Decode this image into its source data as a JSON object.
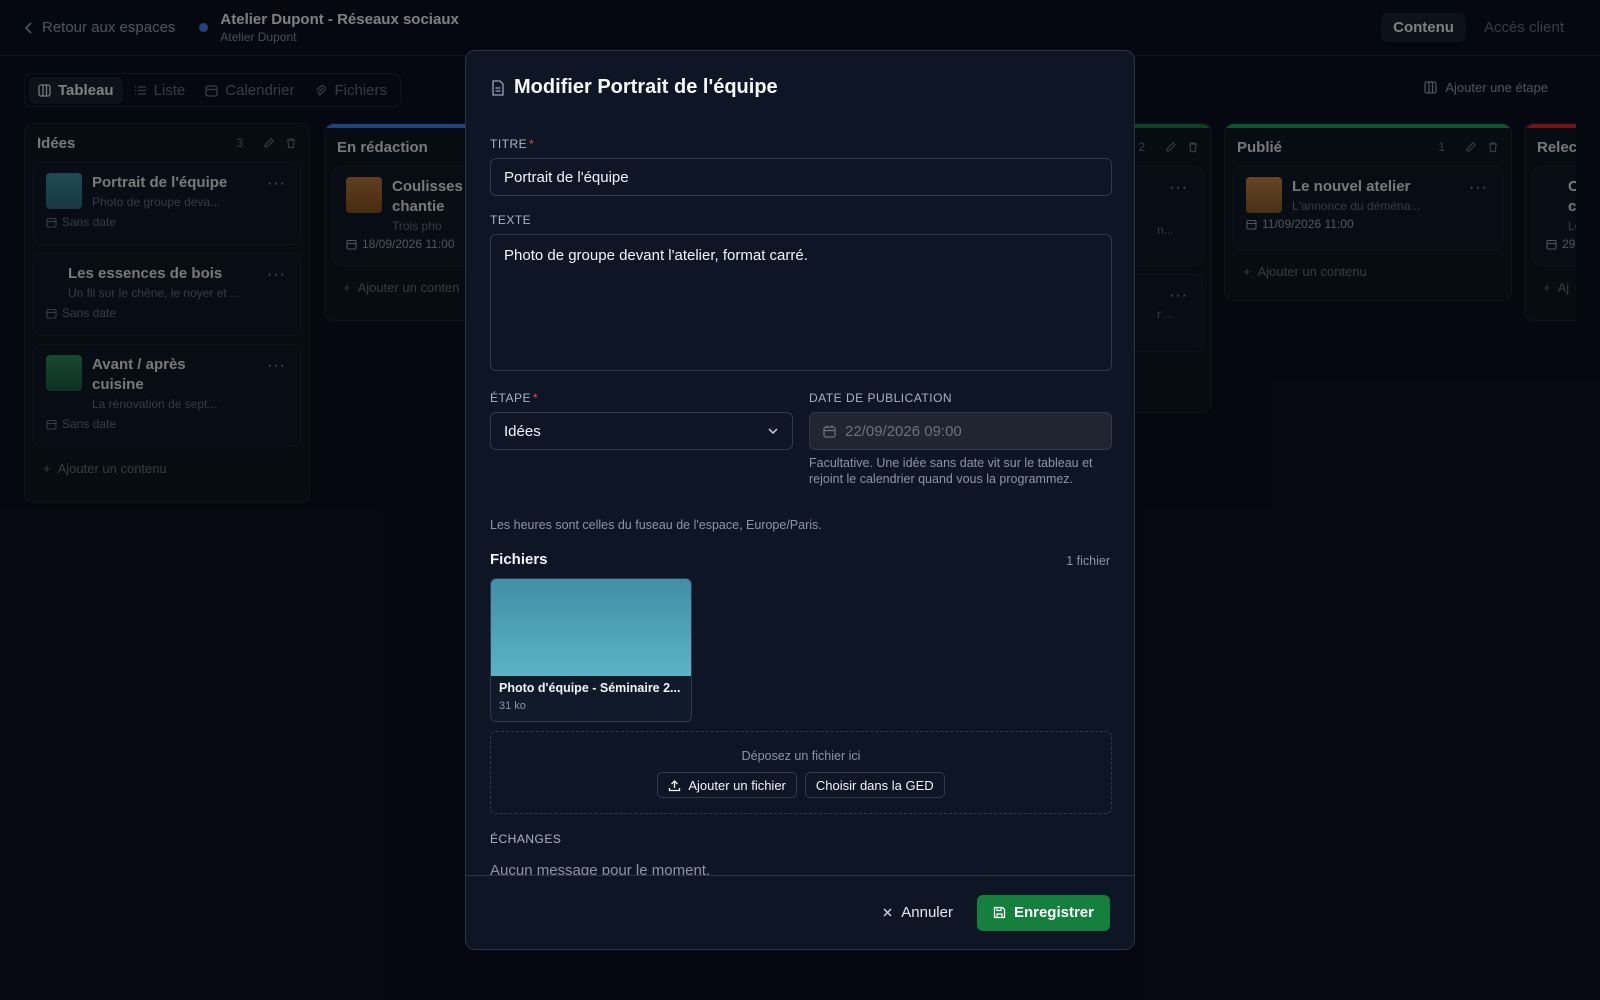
{
  "topbar": {
    "back_label": "Retour aux espaces",
    "workspace_title": "Atelier Dupont - Réseaux sociaux",
    "workspace_subtitle": "Atelier Dupont",
    "tabs": [
      "Contenu",
      "Accès client"
    ]
  },
  "views": {
    "tabs": [
      "Tableau",
      "Liste",
      "Calendrier",
      "Fichiers"
    ],
    "add_stage_label": "Ajouter une étape"
  },
  "board": {
    "columns": [
      {
        "title": "Idées",
        "count": "3",
        "cards": [
          {
            "title": "Portrait de l'équipe",
            "desc": "Photo de groupe deva...",
            "date": "Sans date"
          },
          {
            "title": "Les essences de bois",
            "desc": "Un fil sur le chêne, le noyer et ...",
            "date": "Sans date"
          },
          {
            "title": "Avant / après cuisine",
            "desc": "La rénovation de sept...",
            "date": "Sans date"
          }
        ],
        "add_label": "Ajouter un contenu"
      },
      {
        "title": "En rédaction",
        "cards": [
          {
            "title": "Coulisses chantie",
            "desc": "Trois pho",
            "date": "18/09/2026 11:00"
          }
        ],
        "add_label": "Ajouter un conten"
      },
      {
        "title": "",
        "count": "2",
        "cards": [
          {
            "title": "",
            "desc": "n...",
            "date": ""
          },
          {
            "title": "",
            "desc": "r ...",
            "date": ""
          }
        ]
      },
      {
        "title": "Publié",
        "count": "1",
        "cards": [
          {
            "title": "Le nouvel atelier",
            "desc": "L'annonce du déména...",
            "date": "11/09/2026 11:00"
          }
        ],
        "add_label": "Ajouter un contenu"
      },
      {
        "title": "Relec",
        "cards": [
          {
            "title": "C c",
            "desc": "Le",
            "date": "29"
          }
        ],
        "add_label": "Aj"
      }
    ]
  },
  "modal": {
    "title": "Modifier Portrait de l'équipe",
    "title_label": "TITRE",
    "title_value": "Portrait de l'équipe",
    "text_label": "TEXTE",
    "text_value": "Photo de groupe devant l'atelier, format carré.",
    "stage_label": "ÉTAPE",
    "stage_value": "Idées",
    "date_label": "DATE DE PUBLICATION",
    "date_placeholder": "22/09/2026 09:00",
    "date_help": "Facultative. Une idée sans date vit sur le tableau et rejoint le calendrier quand vous la programmez.",
    "timezone_note": "Les heures sont celles du fuseau de l'espace, Europe/Paris.",
    "files_title": "Fichiers",
    "files_count": "1 fichier",
    "file": {
      "name": "Photo d'équipe - Séminaire 2...",
      "size": "31 ko"
    },
    "drop_label": "Déposez un fichier ici",
    "upload_label": "Ajouter un fichier",
    "ged_label": "Choisir dans la GED",
    "exchanges_label": "ÉCHANGES",
    "no_messages": "Aucun message pour le moment.",
    "cancel_label": "Annuler",
    "save_label": "Enregistrer"
  },
  "colors": {
    "accent_green": "#15803d",
    "required_red": "#ef4444",
    "workspace_dot": "#3b82f6"
  }
}
